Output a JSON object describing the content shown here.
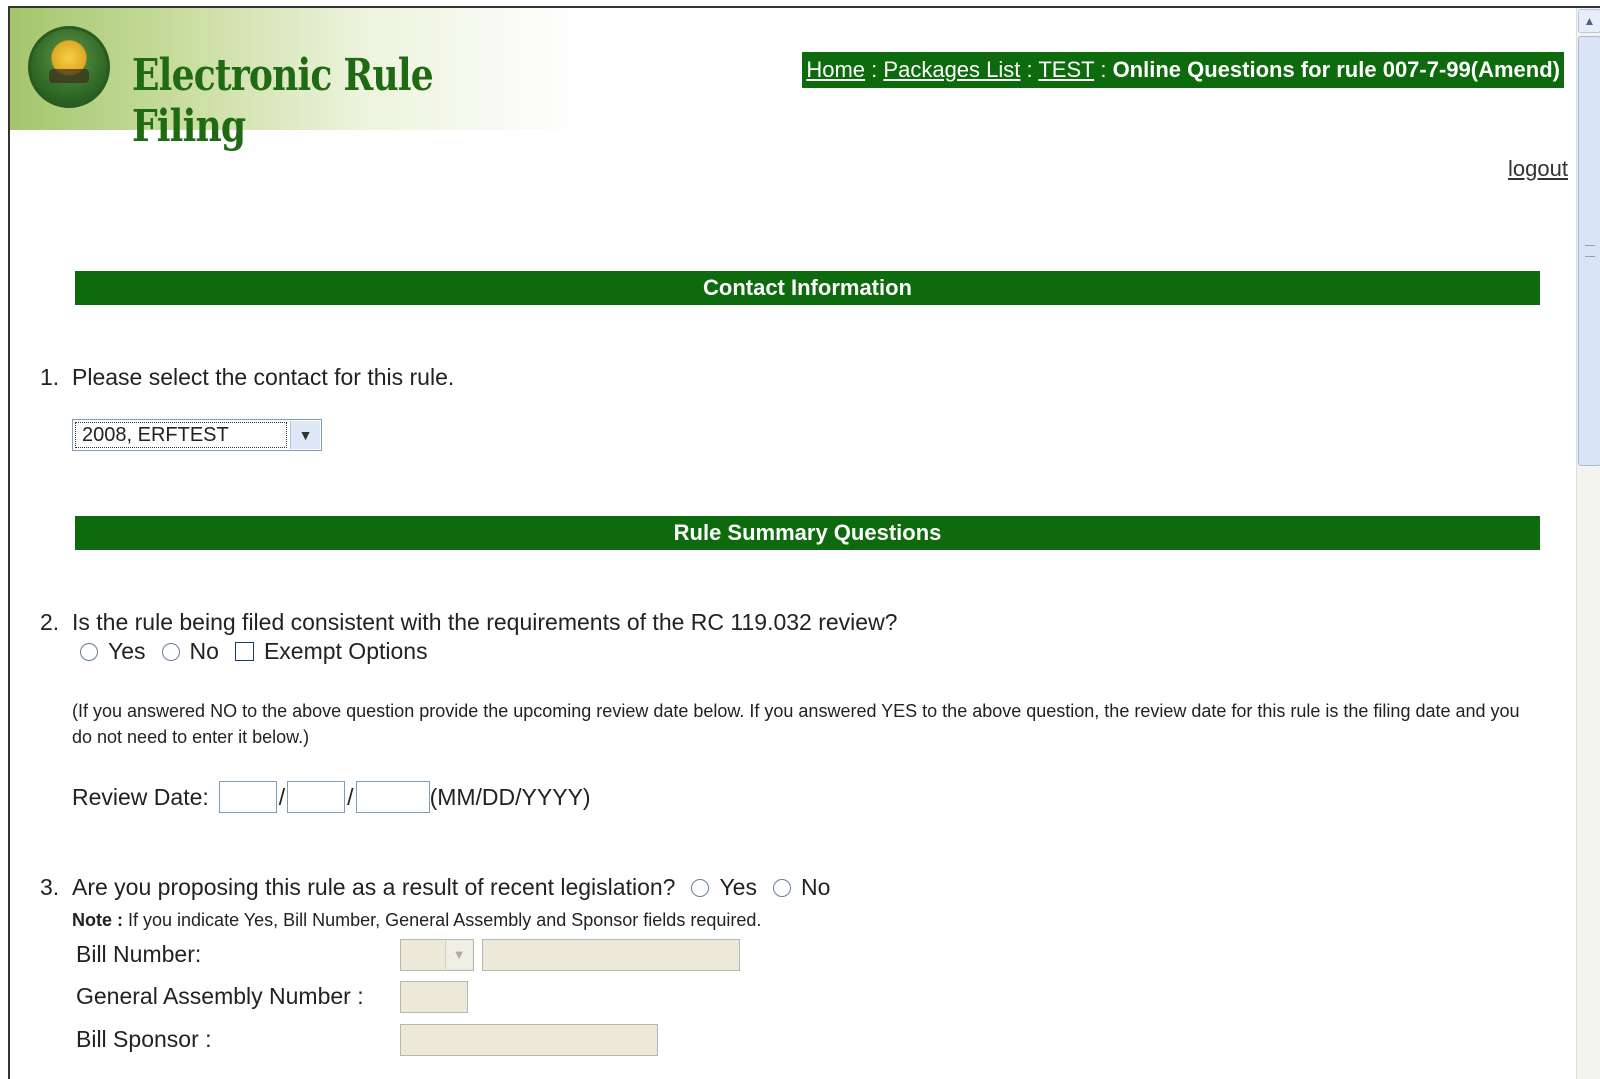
{
  "header": {
    "logo_title": "Electronic Rule Filing",
    "breadcrumb": {
      "home": "Home",
      "sep": ":",
      "packages": "Packages List",
      "test": "TEST",
      "current": "Online Questions for rule 007-7-99(Amend)"
    },
    "logout": "logout"
  },
  "sections": {
    "contact": "Contact Information",
    "summary": "Rule Summary Questions"
  },
  "q1": {
    "num": "1.",
    "text": "Please select the contact for this rule.",
    "selected": "2008, ERFTEST"
  },
  "q2": {
    "num": "2.",
    "text": "Is the rule being filed consistent with the requirements of the RC 119.032 review?",
    "yes": "Yes",
    "no": "No",
    "exempt": "Exempt Options",
    "note": "(If you answered NO to the above question provide the upcoming review date below. If you answered YES to the above question, the review date for this rule is the filing date and you do not need to enter it below.)",
    "review_label": "Review Date:",
    "slash": "/",
    "date_format": "(MM/DD/YYYY)"
  },
  "q3": {
    "num": "3.",
    "text": "Are you proposing this rule as a result of recent legislation?",
    "yes": "Yes",
    "no": "No",
    "note_bold": "Note :",
    "note": "If you indicate Yes, Bill Number, General Assembly and Sponsor fields required.",
    "bill_number": "Bill Number:",
    "general_assembly": "General Assembly Number :",
    "bill_sponsor": "Bill Sponsor :"
  },
  "colors": {
    "accent_green": "#0d6a0d",
    "logo_green": "#1f6a12"
  }
}
